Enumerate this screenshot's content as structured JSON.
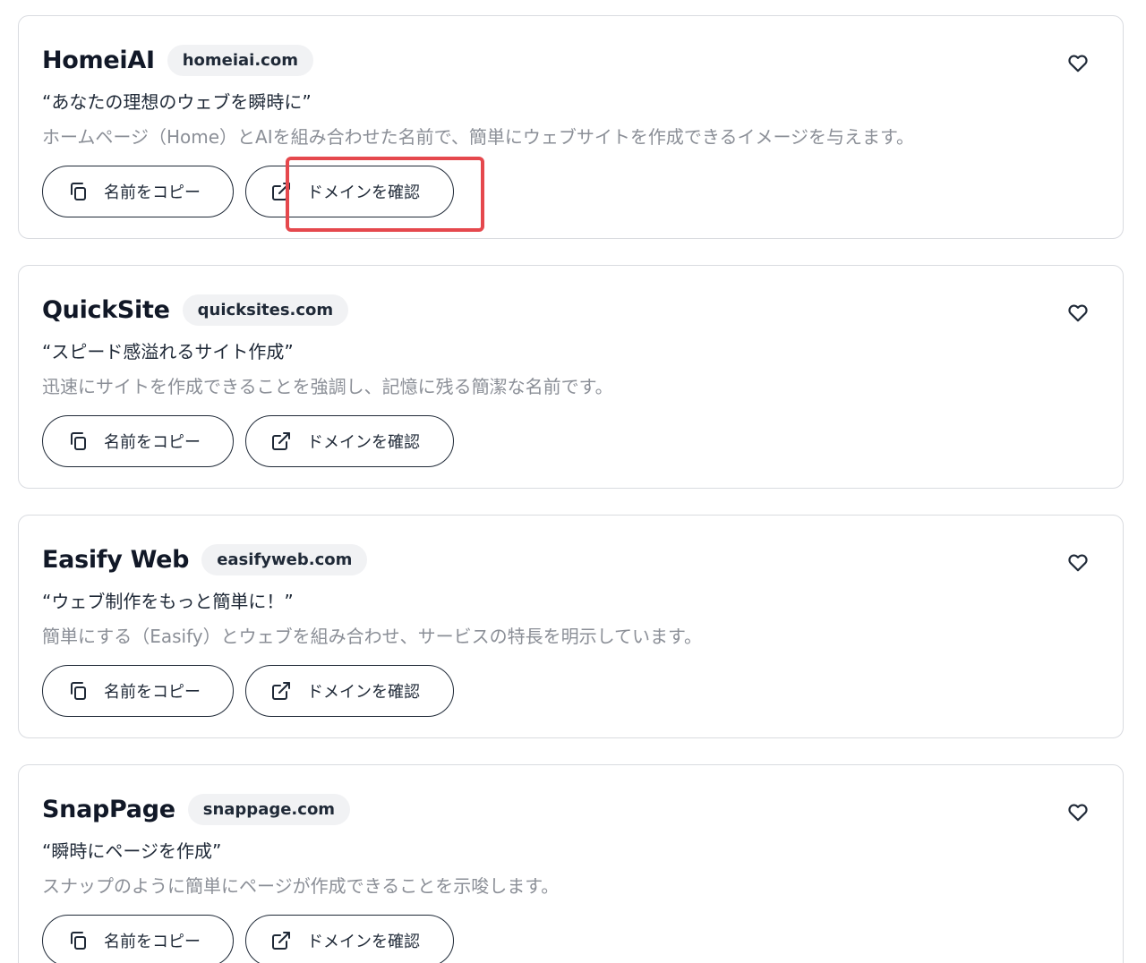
{
  "buttons": {
    "copy_label": "名前をコピー",
    "domain_label": "ドメインを確認"
  },
  "cards": [
    {
      "name": "HomeiAI",
      "domain": "homeiai.com",
      "tagline": "“あなたの理想のウェブを瞬時に”",
      "description": "ホームページ（Home）とAIを組み合わせた名前で、簡単にウェブサイトを作成できるイメージを与えます。"
    },
    {
      "name": "QuickSite",
      "domain": "quicksites.com",
      "tagline": "“スピード感溢れるサイト作成”",
      "description": "迅速にサイトを作成できることを強調し、記憶に残る簡潔な名前です。"
    },
    {
      "name": "Easify Web",
      "domain": "easifyweb.com",
      "tagline": "“ウェブ制作をもっと簡単に！”",
      "description": "簡単にする（Easify）とウェブを組み合わせ、サービスの特長を明示しています。"
    },
    {
      "name": "SnapPage",
      "domain": "snappage.com",
      "tagline": "“瞬時にページを作成”",
      "description": "スナップのように簡単にページが作成できることを示唆します。"
    }
  ],
  "colors": {
    "highlight": "#e5484d",
    "border": "#d9dbe0",
    "pill_bg": "#f1f2f4",
    "muted_text": "#8b8f97"
  },
  "icons": {
    "copy": "copy-icon",
    "domain": "external-link-icon",
    "favorite": "heart-icon"
  }
}
